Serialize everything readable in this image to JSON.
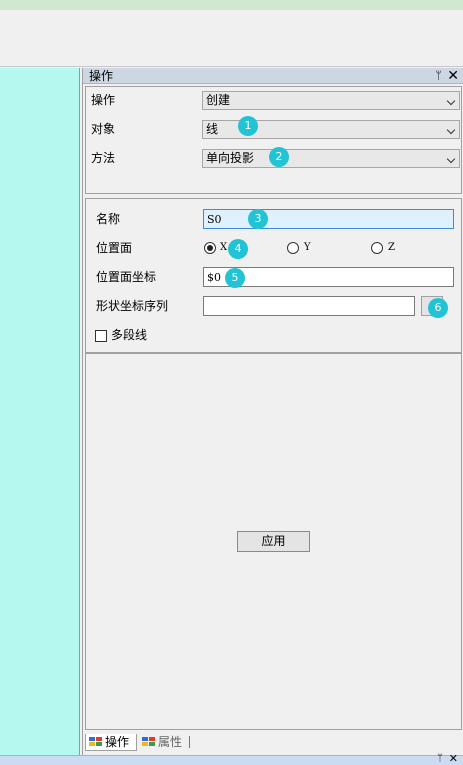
{
  "panel": {
    "title": "操作",
    "pin_glyph": "ᛘ",
    "close_glyph": "✕"
  },
  "top_group": {
    "rows": [
      {
        "label": "操作",
        "value": "创建",
        "badge": ""
      },
      {
        "label": "对象",
        "value": "线",
        "badge": "1"
      },
      {
        "label": "方法",
        "value": "单向投影",
        "badge": "2"
      }
    ]
  },
  "form": {
    "name_label": "名称",
    "name_value": "S0",
    "name_badge": "3",
    "plane_label": "位置面",
    "plane_options": [
      "X",
      "Y",
      "Z"
    ],
    "plane_selected": "X",
    "plane_badge": "4",
    "coord_label": "位置面坐标",
    "coord_value": "$0",
    "coord_badge": "5",
    "shape_label": "形状坐标序列",
    "shape_value": "",
    "shape_badge": "6",
    "polyline_label": "多段线",
    "polyline_checked": false
  },
  "apply_label": "应用",
  "tabs": [
    {
      "label": "操作",
      "active": true
    },
    {
      "label": "属性",
      "active": false
    }
  ],
  "colors": {
    "canvas": "#b5f8f0",
    "badge": "#22c3d4",
    "panel_header": "#cdd7e3"
  },
  "icons": {
    "tab_icon": "window-tab-icon",
    "browse": "browse-icon"
  }
}
